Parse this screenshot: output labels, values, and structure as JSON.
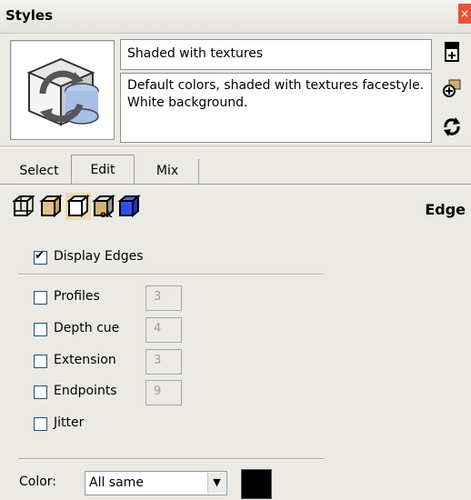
{
  "window": {
    "title": "Styles",
    "close_icon": "×"
  },
  "style": {
    "name": "Shaded with textures",
    "description": "Default colors, shaded with textures facestyle. White background."
  },
  "right_icons": [
    {
      "name": "create-style-icon",
      "glyph": "▦"
    },
    {
      "name": "update-style-icon",
      "glyph": "✎"
    },
    {
      "name": "refresh-icon",
      "glyph": "↻"
    }
  ],
  "tabs": [
    {
      "label": "Select",
      "active": false
    },
    {
      "label": "Edit",
      "active": true
    },
    {
      "label": "Mix",
      "active": false
    }
  ],
  "categories": [
    "edge-settings-icon",
    "face-settings-icon",
    "background-settings-icon",
    "watermark-settings-icon",
    "modeling-settings-icon"
  ],
  "section_title": "Edge",
  "display_edges": {
    "label": "Display Edges",
    "checked": true
  },
  "options": [
    {
      "label": "Profiles",
      "checked": false,
      "value": "3"
    },
    {
      "label": "Depth cue",
      "checked": false,
      "value": "4"
    },
    {
      "label": "Extension",
      "checked": false,
      "value": "3"
    },
    {
      "label": "Endpoints",
      "checked": false,
      "value": "9"
    }
  ],
  "jitter": {
    "label": "Jitter",
    "checked": false
  },
  "color": {
    "label": "Color:",
    "value": "All same",
    "swatch": "#000000"
  }
}
